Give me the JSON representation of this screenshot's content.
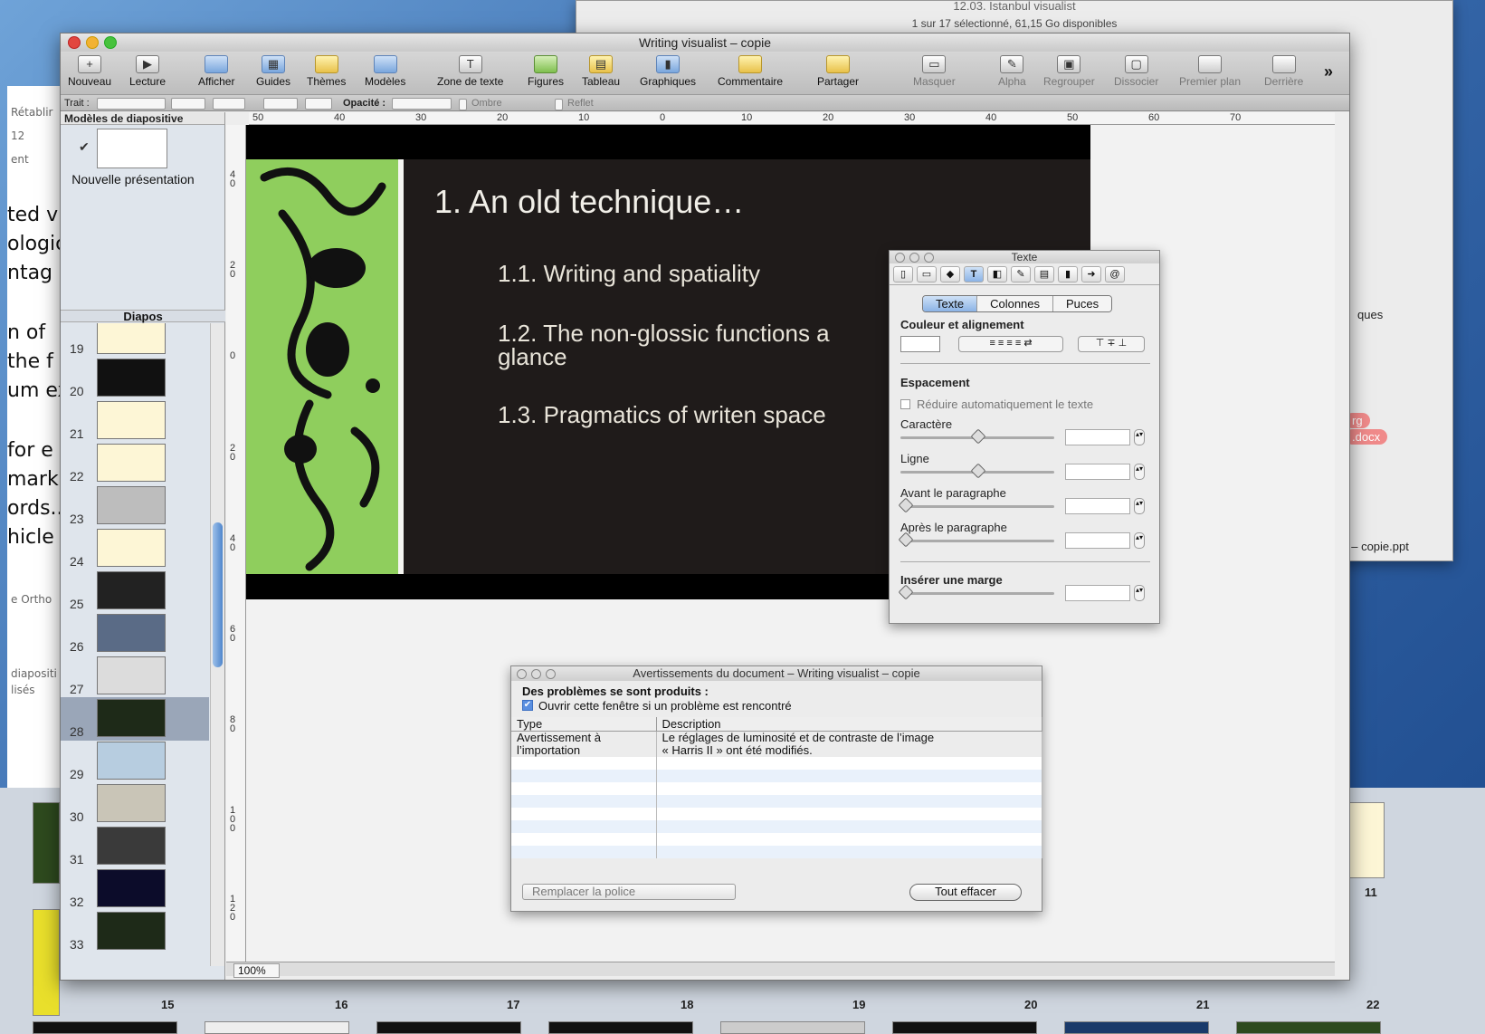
{
  "background_window": {
    "title": "12.03. Istanbul visualist",
    "status": "1 sur 17 sélectionné, 61,15 Go disponibles",
    "right_fragment": "ques",
    "pill_1": "rg",
    "pill_2": ".docx",
    "file_fragment": "t – copie.ppt"
  },
  "left_fragments": {
    "lines": [
      "ted v",
      "ologic",
      "ntag",
      "n of",
      "the f",
      "um ex",
      "for e",
      "mark",
      "ords..",
      "hicle"
    ],
    "small": [
      "Rétablir",
      "12",
      "ent",
      "e Ortho",
      "diapositi",
      "lisés"
    ]
  },
  "bottom_strip": {
    "numbers": [
      "15",
      "16",
      "17",
      "18",
      "19",
      "20",
      "21",
      "22"
    ],
    "right_number": "11"
  },
  "window": {
    "title": "Writing visualist – copie"
  },
  "toolbar": {
    "items": [
      {
        "label": "Nouveau",
        "icon": "plus-icon"
      },
      {
        "label": "Lecture",
        "icon": "play-icon"
      },
      {
        "label": "Afficher",
        "icon": "view-icon"
      },
      {
        "label": "Guides",
        "icon": "guides-icon"
      },
      {
        "label": "Thèmes",
        "icon": "themes-icon"
      },
      {
        "label": "Modèles",
        "icon": "masters-icon"
      },
      {
        "label": "Zone de texte",
        "icon": "text-box-icon"
      },
      {
        "label": "Figures",
        "icon": "shapes-icon"
      },
      {
        "label": "Tableau",
        "icon": "table-icon"
      },
      {
        "label": "Graphiques",
        "icon": "chart-icon"
      },
      {
        "label": "Commentaire",
        "icon": "comment-icon"
      },
      {
        "label": "Partager",
        "icon": "share-icon"
      },
      {
        "label": "Masquer",
        "icon": "mask-icon"
      },
      {
        "label": "Alpha",
        "icon": "alpha-icon"
      },
      {
        "label": "Regrouper",
        "icon": "group-icon"
      },
      {
        "label": "Dissocier",
        "icon": "ungroup-icon"
      },
      {
        "label": "Premier plan",
        "icon": "front-icon"
      },
      {
        "label": "Derrière",
        "icon": "back-icon"
      }
    ],
    "overflow": "»"
  },
  "formatbar": {
    "trait": "Trait :",
    "opacite": "Opacité :",
    "ombre": "Ombre",
    "reflet": "Reflet"
  },
  "sidebar": {
    "masters_header": "Modèles de diapositive",
    "master_label": "Nouvelle présentation",
    "diapos_header": "Diapos",
    "slides": [
      {
        "num": "19",
        "bg": "#fdf6d6"
      },
      {
        "num": "20",
        "bg": "#111"
      },
      {
        "num": "21",
        "bg": "#fdf6d6"
      },
      {
        "num": "22",
        "bg": "#fdf6d6"
      },
      {
        "num": "23",
        "bg": "#bdbdbd"
      },
      {
        "num": "24",
        "bg": "#fdf6d6"
      },
      {
        "num": "25",
        "bg": "#222"
      },
      {
        "num": "26",
        "bg": "#5a6b86"
      },
      {
        "num": "27",
        "bg": "#dcdcdc"
      },
      {
        "num": "28",
        "bg": "#1e2a18"
      },
      {
        "num": "29",
        "bg": "#b7cde0"
      },
      {
        "num": "30",
        "bg": "#c9c5b7"
      },
      {
        "num": "31",
        "bg": "#3a3a3a"
      },
      {
        "num": "32",
        "bg": "#0c0c2a"
      },
      {
        "num": "33",
        "bg": "#1e2a18"
      }
    ],
    "selected_slide": "28"
  },
  "rulers": {
    "h": [
      "50",
      "40",
      "30",
      "20",
      "10",
      "0",
      "10",
      "20",
      "30",
      "40",
      "50",
      "60",
      "70"
    ]
  },
  "slide": {
    "title": "1. An old technique…",
    "bullets": [
      "1.1. Writing and spatiality",
      "1.2. The non-glossic functions a",
      "glance",
      "1.3. Pragmatics of writen space"
    ]
  },
  "zoom": "100%",
  "inspector": {
    "title": "Texte",
    "tabs": [
      "Texte",
      "Colonnes",
      "Puces"
    ],
    "couleur": "Couleur et alignement",
    "espacement": "Espacement",
    "reduire": "Réduire automatiquement le texte",
    "caractere": "Caractère",
    "ligne": "Ligne",
    "avant": "Avant le paragraphe",
    "apres": "Après le paragraphe",
    "marge": "Insérer une marge"
  },
  "warnings": {
    "title": "Avertissements du document – Writing visualist – copie",
    "heading": "Des problèmes se sont produits :",
    "checkbox": "Ouvrir cette fenêtre si un problème est rencontré",
    "col_type": "Type",
    "col_desc": "Description",
    "row_type_1": "Avertissement à",
    "row_type_2": "l’importation",
    "row_desc_1": "Le réglages de luminosité et de contraste de l’image",
    "row_desc_2": "« Harris II » ont été modifiés.",
    "popup": "Remplacer la police",
    "clear": "Tout effacer"
  }
}
